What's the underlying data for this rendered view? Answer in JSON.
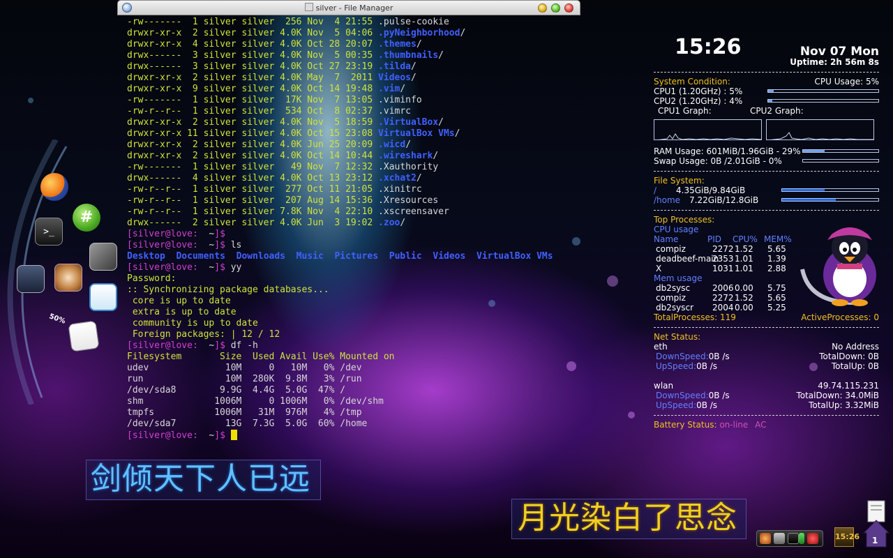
{
  "window": {
    "title": "silver - File Manager"
  },
  "terminal": {
    "listing": [
      {
        "perm": "-rw-------",
        "links": "1",
        "owner": "silver",
        "group": "silver",
        "size": "256",
        "month": "Nov",
        "day": "4",
        "time": "21:55",
        "name": ".pulse-cookie",
        "kind": "hid"
      },
      {
        "perm": "drwxr-xr-x",
        "links": "2",
        "owner": "silver",
        "group": "silver",
        "size": "4.0K",
        "month": "Nov",
        "day": "5",
        "time": "04:06",
        "name": ".pyNeighborhood",
        "kind": "dir"
      },
      {
        "perm": "drwxr-xr-x",
        "links": "4",
        "owner": "silver",
        "group": "silver",
        "size": "4.0K",
        "month": "Oct",
        "day": "28",
        "time": "20:07",
        "name": ".themes",
        "kind": "dir"
      },
      {
        "perm": "drwx------",
        "links": "3",
        "owner": "silver",
        "group": "silver",
        "size": "4.0K",
        "month": "Nov",
        "day": "5",
        "time": "00:35",
        "name": ".thumbnails",
        "kind": "dir"
      },
      {
        "perm": "drwx------",
        "links": "3",
        "owner": "silver",
        "group": "silver",
        "size": "4.0K",
        "month": "Oct",
        "day": "27",
        "time": "23:19",
        "name": ".tilda",
        "kind": "dir"
      },
      {
        "perm": "drwxr-xr-x",
        "links": "2",
        "owner": "silver",
        "group": "silver",
        "size": "4.0K",
        "month": "May",
        "day": "7",
        "time": "2011",
        "name": "Videos",
        "kind": "dir"
      },
      {
        "perm": "drwxr-xr-x",
        "links": "9",
        "owner": "silver",
        "group": "silver",
        "size": "4.0K",
        "month": "Oct",
        "day": "14",
        "time": "19:48",
        "name": ".vim",
        "kind": "dir"
      },
      {
        "perm": "-rw-------",
        "links": "1",
        "owner": "silver",
        "group": "silver",
        "size": "17K",
        "month": "Nov",
        "day": "7",
        "time": "13:05",
        "name": ".viminfo",
        "kind": "hid"
      },
      {
        "perm": "-rw-r--r--",
        "links": "1",
        "owner": "silver",
        "group": "silver",
        "size": "534",
        "month": "Oct",
        "day": "8",
        "time": "02:37",
        "name": ".vimrc",
        "kind": "hid"
      },
      {
        "perm": "drwxr-xr-x",
        "links": "2",
        "owner": "silver",
        "group": "silver",
        "size": "4.0K",
        "month": "Nov",
        "day": "5",
        "time": "18:59",
        "name": ".VirtualBox",
        "kind": "dir"
      },
      {
        "perm": "drwxr-xr-x",
        "links": "11",
        "owner": "silver",
        "group": "silver",
        "size": "4.0K",
        "month": "Oct",
        "day": "15",
        "time": "23:08",
        "name": "VirtualBox VMs",
        "kind": "dir"
      },
      {
        "perm": "drwxr-xr-x",
        "links": "2",
        "owner": "silver",
        "group": "silver",
        "size": "4.0K",
        "month": "Jun",
        "day": "25",
        "time": "20:09",
        "name": ".wicd",
        "kind": "dir"
      },
      {
        "perm": "drwxr-xr-x",
        "links": "2",
        "owner": "silver",
        "group": "silver",
        "size": "4.0K",
        "month": "Oct",
        "day": "14",
        "time": "10:44",
        "name": ".wireshark",
        "kind": "dir"
      },
      {
        "perm": "-rw-------",
        "links": "1",
        "owner": "silver",
        "group": "silver",
        "size": "49",
        "month": "Nov",
        "day": "7",
        "time": "12:32",
        "name": ".Xauthority",
        "kind": "hid"
      },
      {
        "perm": "drwx------",
        "links": "4",
        "owner": "silver",
        "group": "silver",
        "size": "4.0K",
        "month": "Oct",
        "day": "13",
        "time": "23:12",
        "name": ".xchat2",
        "kind": "dir"
      },
      {
        "perm": "-rw-r--r--",
        "links": "1",
        "owner": "silver",
        "group": "silver",
        "size": "277",
        "month": "Oct",
        "day": "11",
        "time": "21:05",
        "name": ".xinitrc",
        "kind": "hid"
      },
      {
        "perm": "-rw-r--r--",
        "links": "1",
        "owner": "silver",
        "group": "silver",
        "size": "207",
        "month": "Aug",
        "day": "14",
        "time": "15:36",
        "name": ".Xresources",
        "kind": "hid"
      },
      {
        "perm": "-rw-r--r--",
        "links": "1",
        "owner": "silver",
        "group": "silver",
        "size": "7.8K",
        "month": "Nov",
        "day": "4",
        "time": "22:10",
        "name": ".xscreensaver",
        "kind": "hid"
      },
      {
        "perm": "drwx------",
        "links": "2",
        "owner": "silver",
        "group": "silver",
        "size": "4.0K",
        "month": "Jun",
        "day": "3",
        "time": "19:02",
        "name": ".zoo",
        "kind": "dir"
      }
    ],
    "prompt": {
      "user": "silver",
      "host": "love",
      "dir": "~"
    },
    "cmd_ls": "ls",
    "ls_items": [
      "Desktop",
      "Documents",
      "Downloads",
      "Music",
      "Pictures",
      "Public",
      "Videos",
      "VirtualBox VMs"
    ],
    "cmd_yy": "yy",
    "password_label": "Password:",
    "sync_header": ":: Synchronizing package databases...",
    "sync_lines": [
      " core is up to date",
      " extra is up to date",
      " community is up to date",
      " Foreign packages: | 12 / 12"
    ],
    "cmd_df": "df -h",
    "df_header": [
      "Filesystem",
      "Size",
      "Used",
      "Avail",
      "Use%",
      "Mounted on"
    ],
    "df_rows": [
      [
        "udev",
        "10M",
        "0",
        "10M",
        "0%",
        "/dev"
      ],
      [
        "run",
        "10M",
        "280K",
        "9.8M",
        "3%",
        "/run"
      ],
      [
        "/dev/sda8",
        "9.9G",
        "4.4G",
        "5.0G",
        "47%",
        "/"
      ],
      [
        "shm",
        "1006M",
        "0",
        "1006M",
        "0%",
        "/dev/shm"
      ],
      [
        "tmpfs",
        "1006M",
        "31M",
        "976M",
        "4%",
        "/tmp"
      ],
      [
        "/dev/sda7",
        "13G",
        "7.3G",
        "5.0G",
        "60%",
        "/home"
      ]
    ]
  },
  "conky": {
    "time": "15:26",
    "date": "Nov 07 Mon",
    "uptime": "Uptime: 2h 56m 8s",
    "system_condition": "System Condition:",
    "cpu_usage_total": "CPU Usage: 5%",
    "cpu1": {
      "label": "CPU1 (1.20GHz) : 5%",
      "percent": 5
    },
    "cpu2": {
      "label": "CPU2 (1.20GHz) : 4%",
      "percent": 4
    },
    "cpu1_graph_label": "CPU1 Graph:",
    "cpu2_graph_label": "CPU2 Graph:",
    "ram": {
      "label": "RAM Usage:  601MiB/1.96GiB - 29%",
      "percent": 29
    },
    "swap": {
      "label": "Swap Usage: 0B  /2.01GiB - 0%",
      "percent": 0
    },
    "filesystem_title": "File System:",
    "fs": [
      {
        "mount": "/",
        "usage": "4.35GiB/9.84GiB",
        "percent": 44
      },
      {
        "mount": "/home",
        "usage": "7.22GiB/12.8GiB",
        "percent": 56
      }
    ],
    "top_title": "Top Processes:",
    "cpu_usage_title": "CPU usage",
    "cols": [
      "Name",
      "PID",
      "CPU%",
      "MEM%"
    ],
    "cpu_procs": [
      [
        "compiz",
        "2272",
        "1.52",
        "5.65"
      ],
      [
        "deadbeef-main",
        "2353",
        "1.01",
        "1.39"
      ],
      [
        "X",
        "1031",
        "1.01",
        "2.88"
      ]
    ],
    "mem_usage_title": "Mem usage",
    "mem_procs": [
      [
        "db2sysc",
        "2006",
        "0.00",
        "5.75"
      ],
      [
        "compiz",
        "2272",
        "1.52",
        "5.65"
      ],
      [
        "db2syscr",
        "2004",
        "0.00",
        "5.25"
      ]
    ],
    "total_processes": "TotalProcesses: 119",
    "active_processes": "ActiveProcesses: 0",
    "net_title": "Net Status:",
    "eth": {
      "name": "eth",
      "address": "No Address",
      "down_label": "DownSpeed:",
      "down": "0B  /s",
      "up_label": "UpSpeed:",
      "up": "0B  /s",
      "total_down": "TotalDown: 0B",
      "total_up": "TotalUp: 0B"
    },
    "wlan": {
      "name": "wlan",
      "address": "49.74.115.231",
      "down_label": "DownSpeed:",
      "down": "0B  /s",
      "up_label": "UpSpeed:",
      "up": "0B  /s",
      "total_down": "TotalDown: 34.0MiB",
      "total_up": "TotalUp: 3.32MiB"
    },
    "battery_label": "Battery Status:",
    "battery_value": "on-line",
    "battery_ac": "AC"
  },
  "dock": {
    "battery_badge": "50%"
  },
  "poems": {
    "left": "剑倾天下人已远",
    "right": "月光染白了思念"
  },
  "tray": {
    "clock": "15:26",
    "workspace": "1"
  },
  "colors": {
    "yellow": "#f0c020",
    "blue_dir": "#4060ff",
    "prompt": "#d040d0",
    "terminal_text": "#cfe33a",
    "bar": "#6f9de6"
  }
}
